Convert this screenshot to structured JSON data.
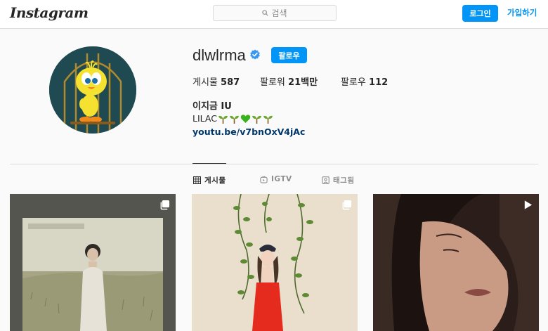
{
  "header": {
    "logo": "Instagram",
    "search_placeholder": "검색",
    "login_label": "로그인",
    "signup_label": "가입하기"
  },
  "profile": {
    "username": "dlwlrma",
    "verified": true,
    "follow_label": "팔로우",
    "posts_label": "게시물",
    "posts_count": "587",
    "followers_label": "팔로워",
    "followers_count": "21백만",
    "following_label": "팔로우",
    "following_count": "112",
    "full_name": "이지금 IU",
    "bio_text": "LILAC",
    "bio_icons": [
      "sprout-icon",
      "sprout-icon",
      "green-heart-icon",
      "sprout-icon",
      "sprout-icon"
    ],
    "link": "youtu.be/v7bnOxV4jAc"
  },
  "tabs": [
    {
      "label": "게시물",
      "icon": "grid-icon",
      "active": true
    },
    {
      "label": "IGTV",
      "icon": "igtv-icon",
      "active": false
    },
    {
      "label": "태그됨",
      "icon": "tagged-icon",
      "active": false
    }
  ],
  "posts": [
    {
      "type": "carousel",
      "icon": "multiple-photos-icon"
    },
    {
      "type": "carousel",
      "icon": "multiple-photos-icon"
    },
    {
      "type": "video",
      "icon": "play-icon"
    }
  ],
  "colors": {
    "accent": "#0095f6",
    "link": "#00376b",
    "border": "#dbdbdb",
    "background": "#fafafa"
  }
}
